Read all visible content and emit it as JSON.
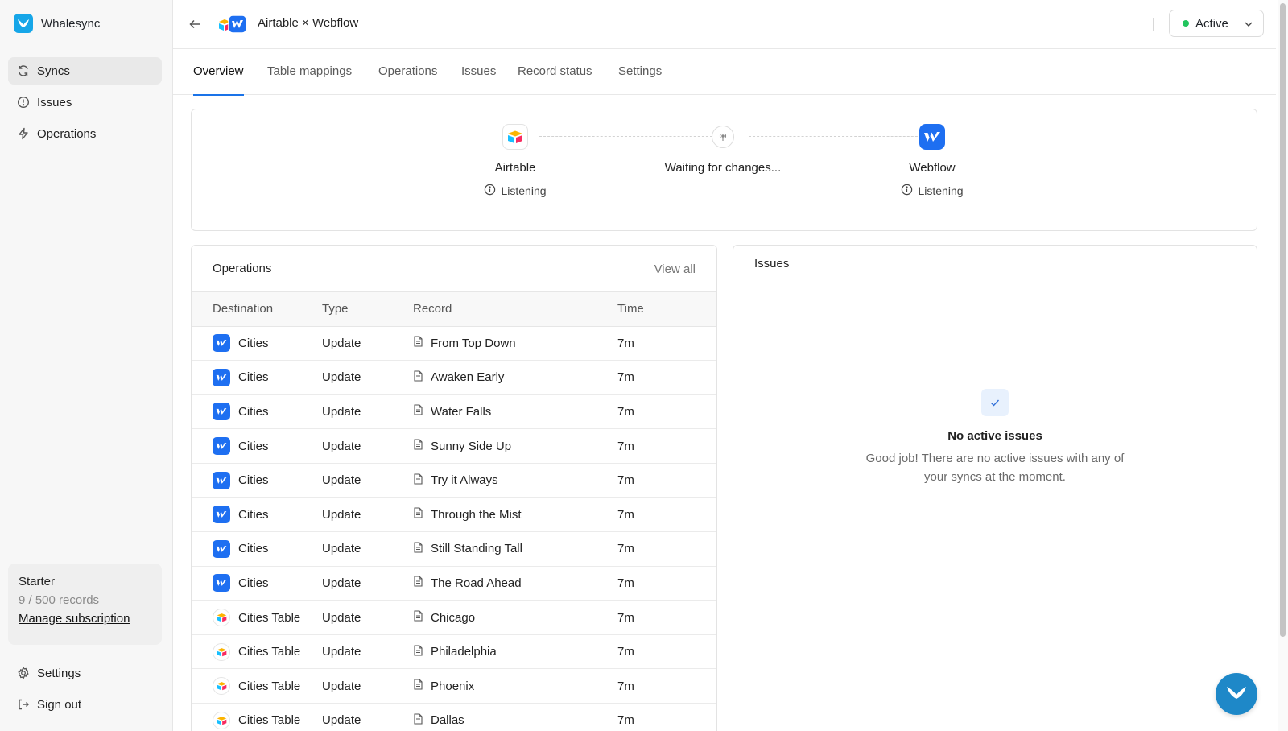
{
  "brand": {
    "name": "Whalesync"
  },
  "sidebar": {
    "items": [
      {
        "label": "Syncs",
        "icon": "refresh-icon",
        "active": true
      },
      {
        "label": "Issues",
        "icon": "alert-circle-icon",
        "active": false
      },
      {
        "label": "Operations",
        "icon": "bolt-icon",
        "active": false
      }
    ],
    "plan": {
      "name": "Starter",
      "records": "9 / 500 records",
      "link": "Manage subscription"
    },
    "bottom": [
      {
        "label": "Settings",
        "icon": "gear-icon"
      },
      {
        "label": "Sign out",
        "icon": "sign-out-icon"
      }
    ]
  },
  "header": {
    "title": "Airtable × Webflow",
    "status": "Active",
    "status_color": "#22c55e"
  },
  "tabs": [
    {
      "label": "Overview",
      "active": true
    },
    {
      "label": "Table mappings",
      "active": false
    },
    {
      "label": "Operations",
      "active": false
    },
    {
      "label": "Issues",
      "active": false
    },
    {
      "label": "Record status",
      "active": false
    },
    {
      "label": "Settings",
      "active": false
    }
  ],
  "flow": {
    "source": {
      "name": "Airtable",
      "status": "Listening"
    },
    "middle": {
      "label": "Waiting for changes..."
    },
    "destination": {
      "name": "Webflow",
      "status": "Listening"
    }
  },
  "operations": {
    "title": "Operations",
    "view_all": "View all",
    "columns": [
      "Destination",
      "Type",
      "Record",
      "Time"
    ],
    "rows": [
      {
        "app": "webflow",
        "destination": "Cities",
        "type": "Update",
        "record": "From Top Down",
        "time": "7m"
      },
      {
        "app": "webflow",
        "destination": "Cities",
        "type": "Update",
        "record": "Awaken Early",
        "time": "7m"
      },
      {
        "app": "webflow",
        "destination": "Cities",
        "type": "Update",
        "record": "Water Falls",
        "time": "7m"
      },
      {
        "app": "webflow",
        "destination": "Cities",
        "type": "Update",
        "record": "Sunny Side Up",
        "time": "7m"
      },
      {
        "app": "webflow",
        "destination": "Cities",
        "type": "Update",
        "record": "Try it Always",
        "time": "7m"
      },
      {
        "app": "webflow",
        "destination": "Cities",
        "type": "Update",
        "record": "Through the Mist",
        "time": "7m"
      },
      {
        "app": "webflow",
        "destination": "Cities",
        "type": "Update",
        "record": "Still Standing Tall",
        "time": "7m"
      },
      {
        "app": "webflow",
        "destination": "Cities",
        "type": "Update",
        "record": "The Road Ahead",
        "time": "7m"
      },
      {
        "app": "airtable",
        "destination": "Cities Table",
        "type": "Update",
        "record": "Chicago",
        "time": "7m"
      },
      {
        "app": "airtable",
        "destination": "Cities Table",
        "type": "Update",
        "record": "Philadelphia",
        "time": "7m"
      },
      {
        "app": "airtable",
        "destination": "Cities Table",
        "type": "Update",
        "record": "Phoenix",
        "time": "7m"
      },
      {
        "app": "airtable",
        "destination": "Cities Table",
        "type": "Update",
        "record": "Dallas",
        "time": "7m"
      }
    ]
  },
  "issues": {
    "title": "Issues",
    "empty_title": "No active issues",
    "empty_desc": "Good job! There are no active issues with any of your syncs at the moment."
  },
  "colors": {
    "accent": "#1a73e8",
    "webflow": "#1e6ff1",
    "whalesync": "#16a6e8"
  }
}
